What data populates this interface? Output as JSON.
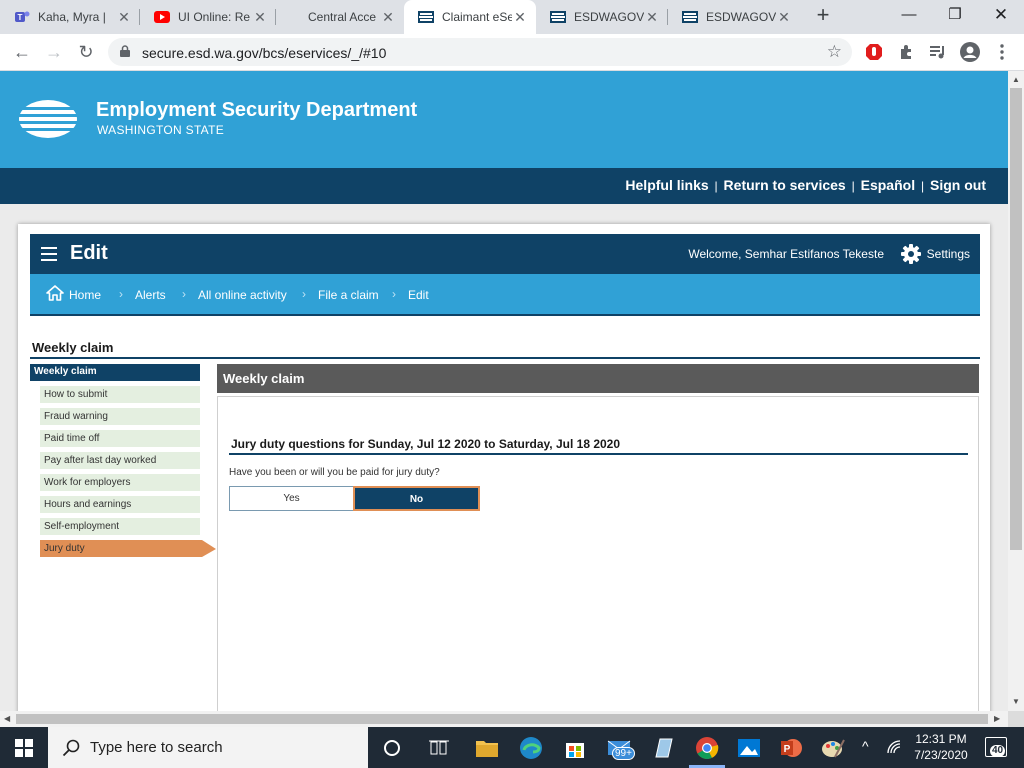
{
  "browser": {
    "tabs": [
      {
        "title": "Kaha, Myra |",
        "icon": "teams-icon",
        "active": false
      },
      {
        "title": "UI Online: Re",
        "icon": "youtube-icon",
        "active": false
      },
      {
        "title": "Central Acce",
        "icon": "",
        "active": false
      },
      {
        "title": "Claimant eSe",
        "icon": "esd-favicon-icon",
        "active": true
      },
      {
        "title": "ESDWAGOV",
        "icon": "esd-favicon-icon",
        "active": false
      },
      {
        "title": "ESDWAGOV",
        "icon": "esd-favicon-icon",
        "active": false
      }
    ],
    "url": "secure.esd.wa.gov/bcs/eservices/_/#10"
  },
  "site": {
    "name": "Employment Security Department",
    "state": "WASHINGTON STATE",
    "top_links": [
      "Helpful links",
      "Return to services",
      "Español",
      "Sign out"
    ],
    "separator": "|"
  },
  "app": {
    "title": "Edit",
    "welcome": "Welcome, Semhar Estifanos Tekeste",
    "settings_label": "Settings",
    "breadcrumbs": [
      "Home",
      "Alerts",
      "All online activity",
      "File a claim",
      "Edit"
    ]
  },
  "section": {
    "title": "Weekly claim"
  },
  "sidebar": {
    "header": "Weekly claim",
    "items": [
      {
        "label": "How to submit",
        "active": false
      },
      {
        "label": "Fraud warning",
        "active": false
      },
      {
        "label": "Paid time off",
        "active": false
      },
      {
        "label": "Pay after last day worked",
        "active": false
      },
      {
        "label": "Work for employers",
        "active": false
      },
      {
        "label": "Hours and earnings",
        "active": false
      },
      {
        "label": "Self-employment",
        "active": false
      },
      {
        "label": "Jury duty",
        "active": true
      }
    ]
  },
  "panel": {
    "header": "Weekly claim",
    "question_title": "Jury duty questions for Sunday, Jul 12 2020 to Saturday, Jul 18 2020",
    "question": "Have you been or will you be paid for jury duty?",
    "yes_label": "Yes",
    "no_label": "No",
    "selected": "No"
  },
  "taskbar": {
    "search_placeholder": "Type here to search",
    "mail_badge": "99+",
    "time": "12:31 PM",
    "date": "7/23/2020",
    "notifications": "40"
  },
  "colors": {
    "esd_blue": "#30a1d6",
    "esd_navy": "#0f4266",
    "active_orange": "#e08f55",
    "panel_gray": "#5a5a5a"
  }
}
